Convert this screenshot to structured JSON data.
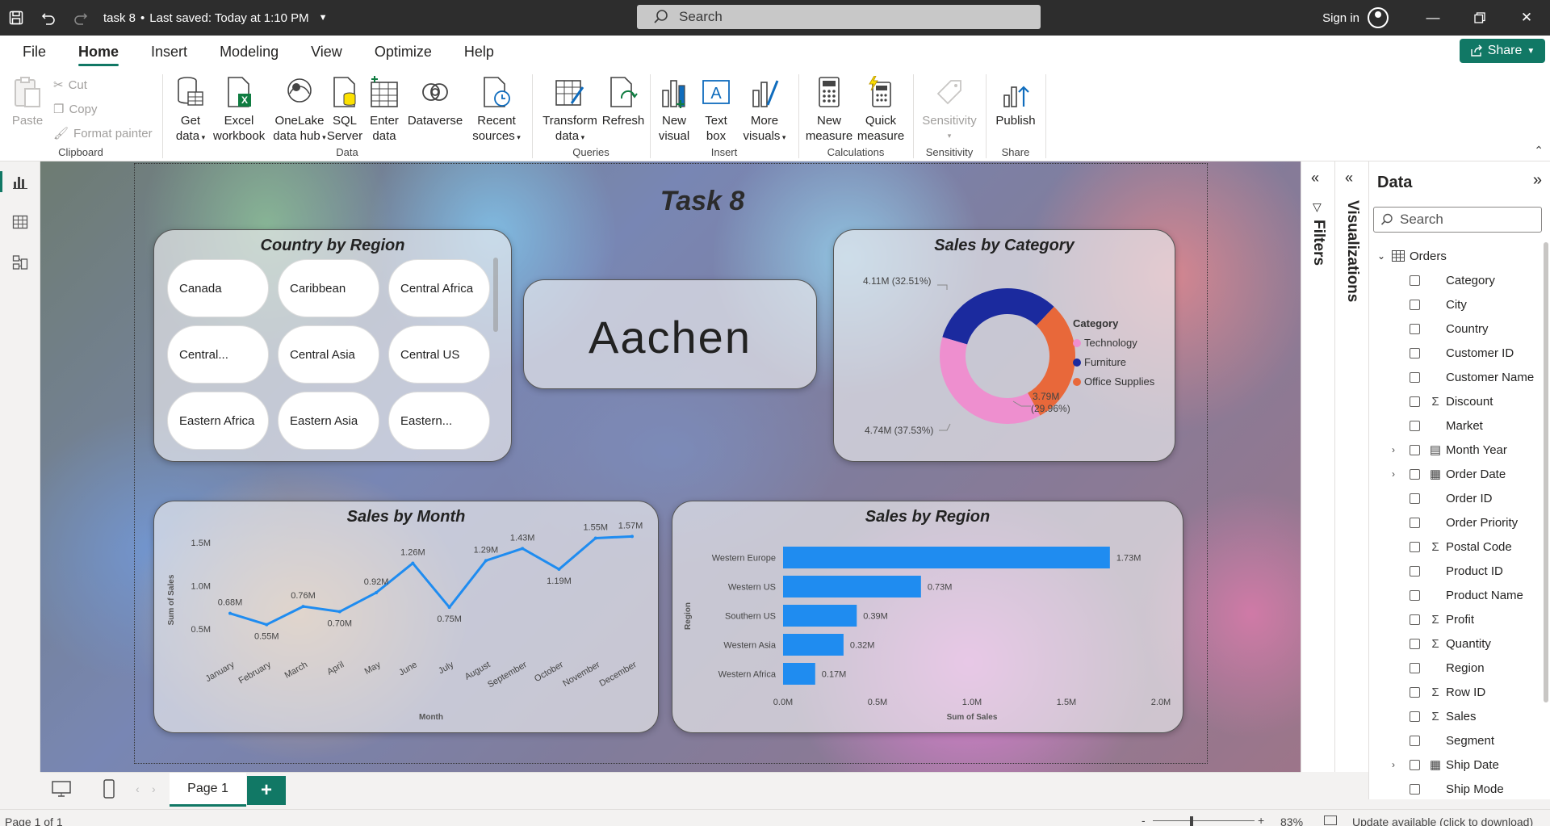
{
  "titlebar": {
    "doc_title": "task 8",
    "saved_status": "Last saved: Today at 1:10 PM",
    "search_placeholder": "Search",
    "signin_label": "Sign in"
  },
  "menu": {
    "items": [
      "File",
      "Home",
      "Insert",
      "Modeling",
      "View",
      "Optimize",
      "Help"
    ],
    "active": "Home",
    "share_label": "Share"
  },
  "ribbon": {
    "clipboard": {
      "paste": "Paste",
      "cut": "Cut",
      "copy": "Copy",
      "format_painter": "Format painter",
      "group": "Clipboard"
    },
    "data": {
      "get_data": [
        "Get",
        "data"
      ],
      "excel": [
        "Excel",
        "workbook"
      ],
      "onelake": [
        "OneLake",
        "data hub"
      ],
      "sql": [
        "SQL",
        "Server"
      ],
      "enter": [
        "Enter",
        "data"
      ],
      "dataverse": [
        "Dataverse",
        ""
      ],
      "recent": [
        "Recent",
        "sources"
      ],
      "group": "Data"
    },
    "queries": {
      "transform": [
        "Transform",
        "data"
      ],
      "refresh": [
        "Refresh",
        ""
      ],
      "group": "Queries"
    },
    "insert": {
      "new_visual": [
        "New",
        "visual"
      ],
      "text_box": [
        "Text",
        "box"
      ],
      "more_visuals": [
        "More",
        "visuals"
      ],
      "group": "Insert"
    },
    "calculations": {
      "new_measure": [
        "New",
        "measure"
      ],
      "quick_measure": [
        "Quick",
        "measure"
      ],
      "group": "Calculations"
    },
    "sensitivity": {
      "label": "Sensitivity",
      "group": "Sensitivity"
    },
    "share": {
      "publish": "Publish",
      "group": "Share"
    }
  },
  "report": {
    "title": "Task 8",
    "slicer": {
      "title": "Country by Region",
      "items": [
        "Canada",
        "Caribbean",
        "Central Africa",
        "Central...",
        "Central Asia",
        "Central US",
        "Eastern Africa",
        "Eastern Asia",
        "Eastern..."
      ]
    },
    "card": {
      "value": "Aachen"
    },
    "category_chart": {
      "title": "Sales by Category",
      "legend_title": "Category",
      "labels": {
        "technology": "4.74M (37.53%)",
        "furniture": "4.11M (32.51%)",
        "office_line1": "3.79M",
        "office_line2": "(29.96%)"
      }
    },
    "month_chart": {
      "title": "Sales by Month"
    },
    "region_chart": {
      "title": "Sales by Region"
    }
  },
  "chart_data": [
    {
      "type": "pie",
      "title": "Sales by Category",
      "legend_title": "Category",
      "series": [
        {
          "name": "Technology",
          "value": 4.74,
          "percent": 37.53,
          "color": "#ee8fcf"
        },
        {
          "name": "Furniture",
          "value": 4.11,
          "percent": 32.51,
          "color": "#1b2a9e"
        },
        {
          "name": "Office Supplies",
          "value": 3.79,
          "percent": 29.96,
          "color": "#e8683a"
        }
      ],
      "unit": "M"
    },
    {
      "type": "line",
      "title": "Sales by Month",
      "xlabel": "Month",
      "ylabel": "Sum of Sales",
      "categories": [
        "January",
        "February",
        "March",
        "April",
        "May",
        "June",
        "July",
        "August",
        "September",
        "October",
        "November",
        "December"
      ],
      "values": [
        0.68,
        0.55,
        0.76,
        0.7,
        0.92,
        1.26,
        0.75,
        1.29,
        1.43,
        1.19,
        1.55,
        1.57
      ],
      "data_labels": [
        "0.68M",
        "0.55M",
        "0.76M",
        "0.70M",
        "0.92M",
        "1.26M",
        "0.75M",
        "1.29M",
        "1.43M",
        "1.19M",
        "1.55M",
        "1.57M"
      ],
      "yticks": [
        "0.5M",
        "1.0M",
        "1.5M"
      ],
      "ytick_values": [
        0.5,
        1.0,
        1.5
      ],
      "ylim": [
        0.35,
        1.62
      ],
      "color": "#1f8cf0"
    },
    {
      "type": "bar",
      "orientation": "horizontal",
      "title": "Sales by Region",
      "xlabel": "Sum of Sales",
      "ylabel": "Region",
      "categories": [
        "Western Europe",
        "Western US",
        "Southern US",
        "Western Asia",
        "Western Africa"
      ],
      "values": [
        1.73,
        0.73,
        0.39,
        0.32,
        0.17
      ],
      "data_labels": [
        "1.73M",
        "0.73M",
        "0.39M",
        "0.32M",
        "0.17M"
      ],
      "xticks": [
        "0.0M",
        "0.5M",
        "1.0M",
        "1.5M",
        "2.0M"
      ],
      "xtick_values": [
        0,
        0.5,
        1.0,
        1.5,
        2.0
      ],
      "xlim": [
        0,
        2.0
      ],
      "color": "#1f8cf0"
    }
  ],
  "panes": {
    "filters_label": "Filters",
    "visualizations_label": "Visualizations",
    "data": {
      "title": "Data",
      "search_placeholder": "Search",
      "table_name": "Orders",
      "fields": [
        {
          "name": "Category",
          "icon": "",
          "expand": false
        },
        {
          "name": "City",
          "icon": "",
          "expand": false
        },
        {
          "name": "Country",
          "icon": "",
          "expand": false
        },
        {
          "name": "Customer ID",
          "icon": "",
          "expand": false
        },
        {
          "name": "Customer Name",
          "icon": "",
          "expand": false
        },
        {
          "name": "Discount",
          "icon": "sigma",
          "expand": false
        },
        {
          "name": "Market",
          "icon": "",
          "expand": false
        },
        {
          "name": "Month Year",
          "icon": "calendar-hierarchy",
          "expand": true
        },
        {
          "name": "Order Date",
          "icon": "calendar",
          "expand": true
        },
        {
          "name": "Order ID",
          "icon": "",
          "expand": false
        },
        {
          "name": "Order Priority",
          "icon": "",
          "expand": false
        },
        {
          "name": "Postal Code",
          "icon": "sigma",
          "expand": false
        },
        {
          "name": "Product ID",
          "icon": "",
          "expand": false
        },
        {
          "name": "Product Name",
          "icon": "",
          "expand": false
        },
        {
          "name": "Profit",
          "icon": "sigma",
          "expand": false
        },
        {
          "name": "Quantity",
          "icon": "sigma",
          "expand": false
        },
        {
          "name": "Region",
          "icon": "",
          "expand": false
        },
        {
          "name": "Row ID",
          "icon": "sigma",
          "expand": false
        },
        {
          "name": "Sales",
          "icon": "sigma",
          "expand": false
        },
        {
          "name": "Segment",
          "icon": "",
          "expand": false
        },
        {
          "name": "Ship Date",
          "icon": "calendar",
          "expand": true
        },
        {
          "name": "Ship Mode",
          "icon": "",
          "expand": false
        }
      ]
    }
  },
  "pages": {
    "tab": "Page 1",
    "add": "+"
  },
  "status": {
    "page_info": "Page 1 of 1",
    "zoom": "83%",
    "update": "Update available (click to download)"
  }
}
